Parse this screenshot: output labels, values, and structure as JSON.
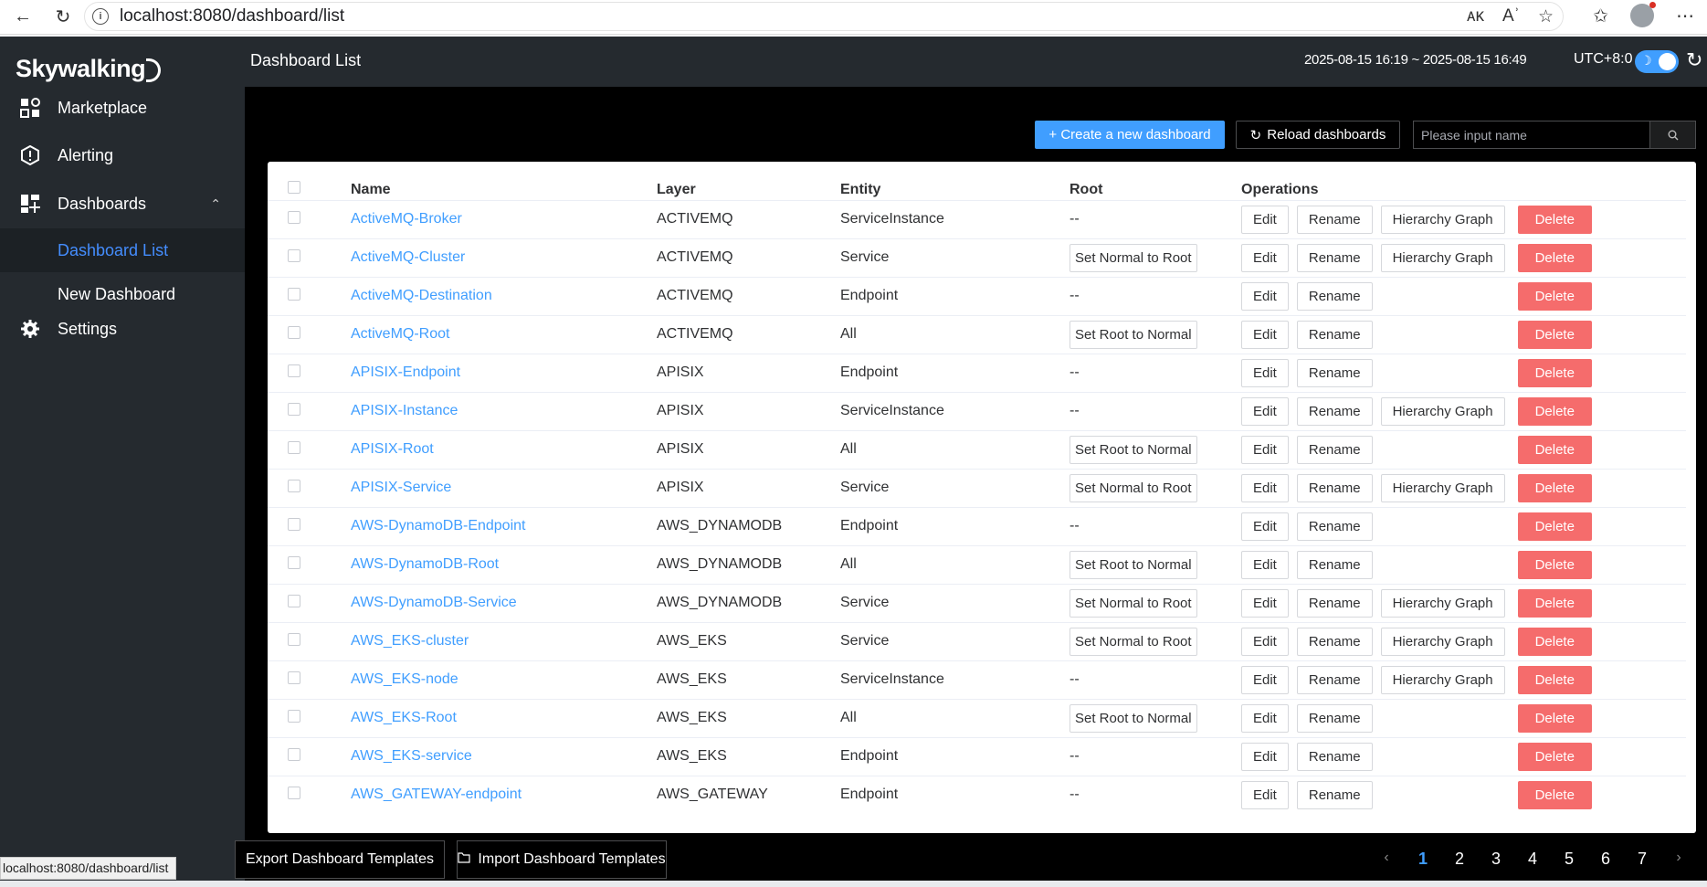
{
  "browser": {
    "url": "localhost:8080/dashboard/list",
    "status_url": "localhost:8080/dashboard/list"
  },
  "app": {
    "logo_text": "Skywalking",
    "menu": [
      {
        "label": "Marketplace",
        "icon": "marketplace-icon"
      },
      {
        "label": "Alerting",
        "icon": "alerting-icon"
      },
      {
        "label": "Dashboards",
        "icon": "dashboards-icon"
      },
      {
        "label": "Settings",
        "icon": "settings-icon"
      }
    ],
    "submenu": [
      {
        "label": "Dashboard List",
        "active": true
      },
      {
        "label": "New Dashboard",
        "active": false
      }
    ]
  },
  "topbar": {
    "title": "Dashboard List",
    "time_range": "2025-08-15 16:19 ~ 2025-08-15 16:49",
    "timezone": "UTC+8:0"
  },
  "toolbar": {
    "create_label": "+ Create a new dashboard",
    "reload_label": "Reload dashboards",
    "search_placeholder": "Please input name"
  },
  "table": {
    "headers": {
      "name": "Name",
      "layer": "Layer",
      "entity": "Entity",
      "root": "Root",
      "operations": "Operations"
    },
    "ops": {
      "edit": "Edit",
      "rename": "Rename",
      "hierarchy": "Hierarchy Graph",
      "delete": "Delete"
    },
    "rows": [
      {
        "name": "ActiveMQ-Broker",
        "layer": "ACTIVEMQ",
        "entity": "ServiceInstance",
        "root": "--",
        "hierarchy": true
      },
      {
        "name": "ActiveMQ-Cluster",
        "layer": "ACTIVEMQ",
        "entity": "Service",
        "root": "Set Normal to Root",
        "hierarchy": true
      },
      {
        "name": "ActiveMQ-Destination",
        "layer": "ACTIVEMQ",
        "entity": "Endpoint",
        "root": "--",
        "hierarchy": false
      },
      {
        "name": "ActiveMQ-Root",
        "layer": "ACTIVEMQ",
        "entity": "All",
        "root": "Set Root to Normal",
        "hierarchy": false
      },
      {
        "name": "APISIX-Endpoint",
        "layer": "APISIX",
        "entity": "Endpoint",
        "root": "--",
        "hierarchy": false
      },
      {
        "name": "APISIX-Instance",
        "layer": "APISIX",
        "entity": "ServiceInstance",
        "root": "--",
        "hierarchy": true
      },
      {
        "name": "APISIX-Root",
        "layer": "APISIX",
        "entity": "All",
        "root": "Set Root to Normal",
        "hierarchy": false
      },
      {
        "name": "APISIX-Service",
        "layer": "APISIX",
        "entity": "Service",
        "root": "Set Normal to Root",
        "hierarchy": true
      },
      {
        "name": "AWS-DynamoDB-Endpoint",
        "layer": "AWS_DYNAMODB",
        "entity": "Endpoint",
        "root": "--",
        "hierarchy": false
      },
      {
        "name": "AWS-DynamoDB-Root",
        "layer": "AWS_DYNAMODB",
        "entity": "All",
        "root": "Set Root to Normal",
        "hierarchy": false
      },
      {
        "name": "AWS-DynamoDB-Service",
        "layer": "AWS_DYNAMODB",
        "entity": "Service",
        "root": "Set Normal to Root",
        "hierarchy": true
      },
      {
        "name": "AWS_EKS-cluster",
        "layer": "AWS_EKS",
        "entity": "Service",
        "root": "Set Normal to Root",
        "hierarchy": true
      },
      {
        "name": "AWS_EKS-node",
        "layer": "AWS_EKS",
        "entity": "ServiceInstance",
        "root": "--",
        "hierarchy": true
      },
      {
        "name": "AWS_EKS-Root",
        "layer": "AWS_EKS",
        "entity": "All",
        "root": "Set Root to Normal",
        "hierarchy": false
      },
      {
        "name": "AWS_EKS-service",
        "layer": "AWS_EKS",
        "entity": "Endpoint",
        "root": "--",
        "hierarchy": false
      },
      {
        "name": "AWS_GATEWAY-endpoint",
        "layer": "AWS_GATEWAY",
        "entity": "Endpoint",
        "root": "--",
        "hierarchy": false
      }
    ]
  },
  "footer": {
    "export_label": "Export Dashboard Templates",
    "import_label": "Import Dashboard Templates",
    "pages": [
      "1",
      "2",
      "3",
      "4",
      "5",
      "6",
      "7"
    ],
    "current_page": "1"
  },
  "colors": {
    "accent": "#409eff",
    "danger": "#f56c6c",
    "sidebar_bg": "#252a2f",
    "main_bg": "#000000"
  }
}
